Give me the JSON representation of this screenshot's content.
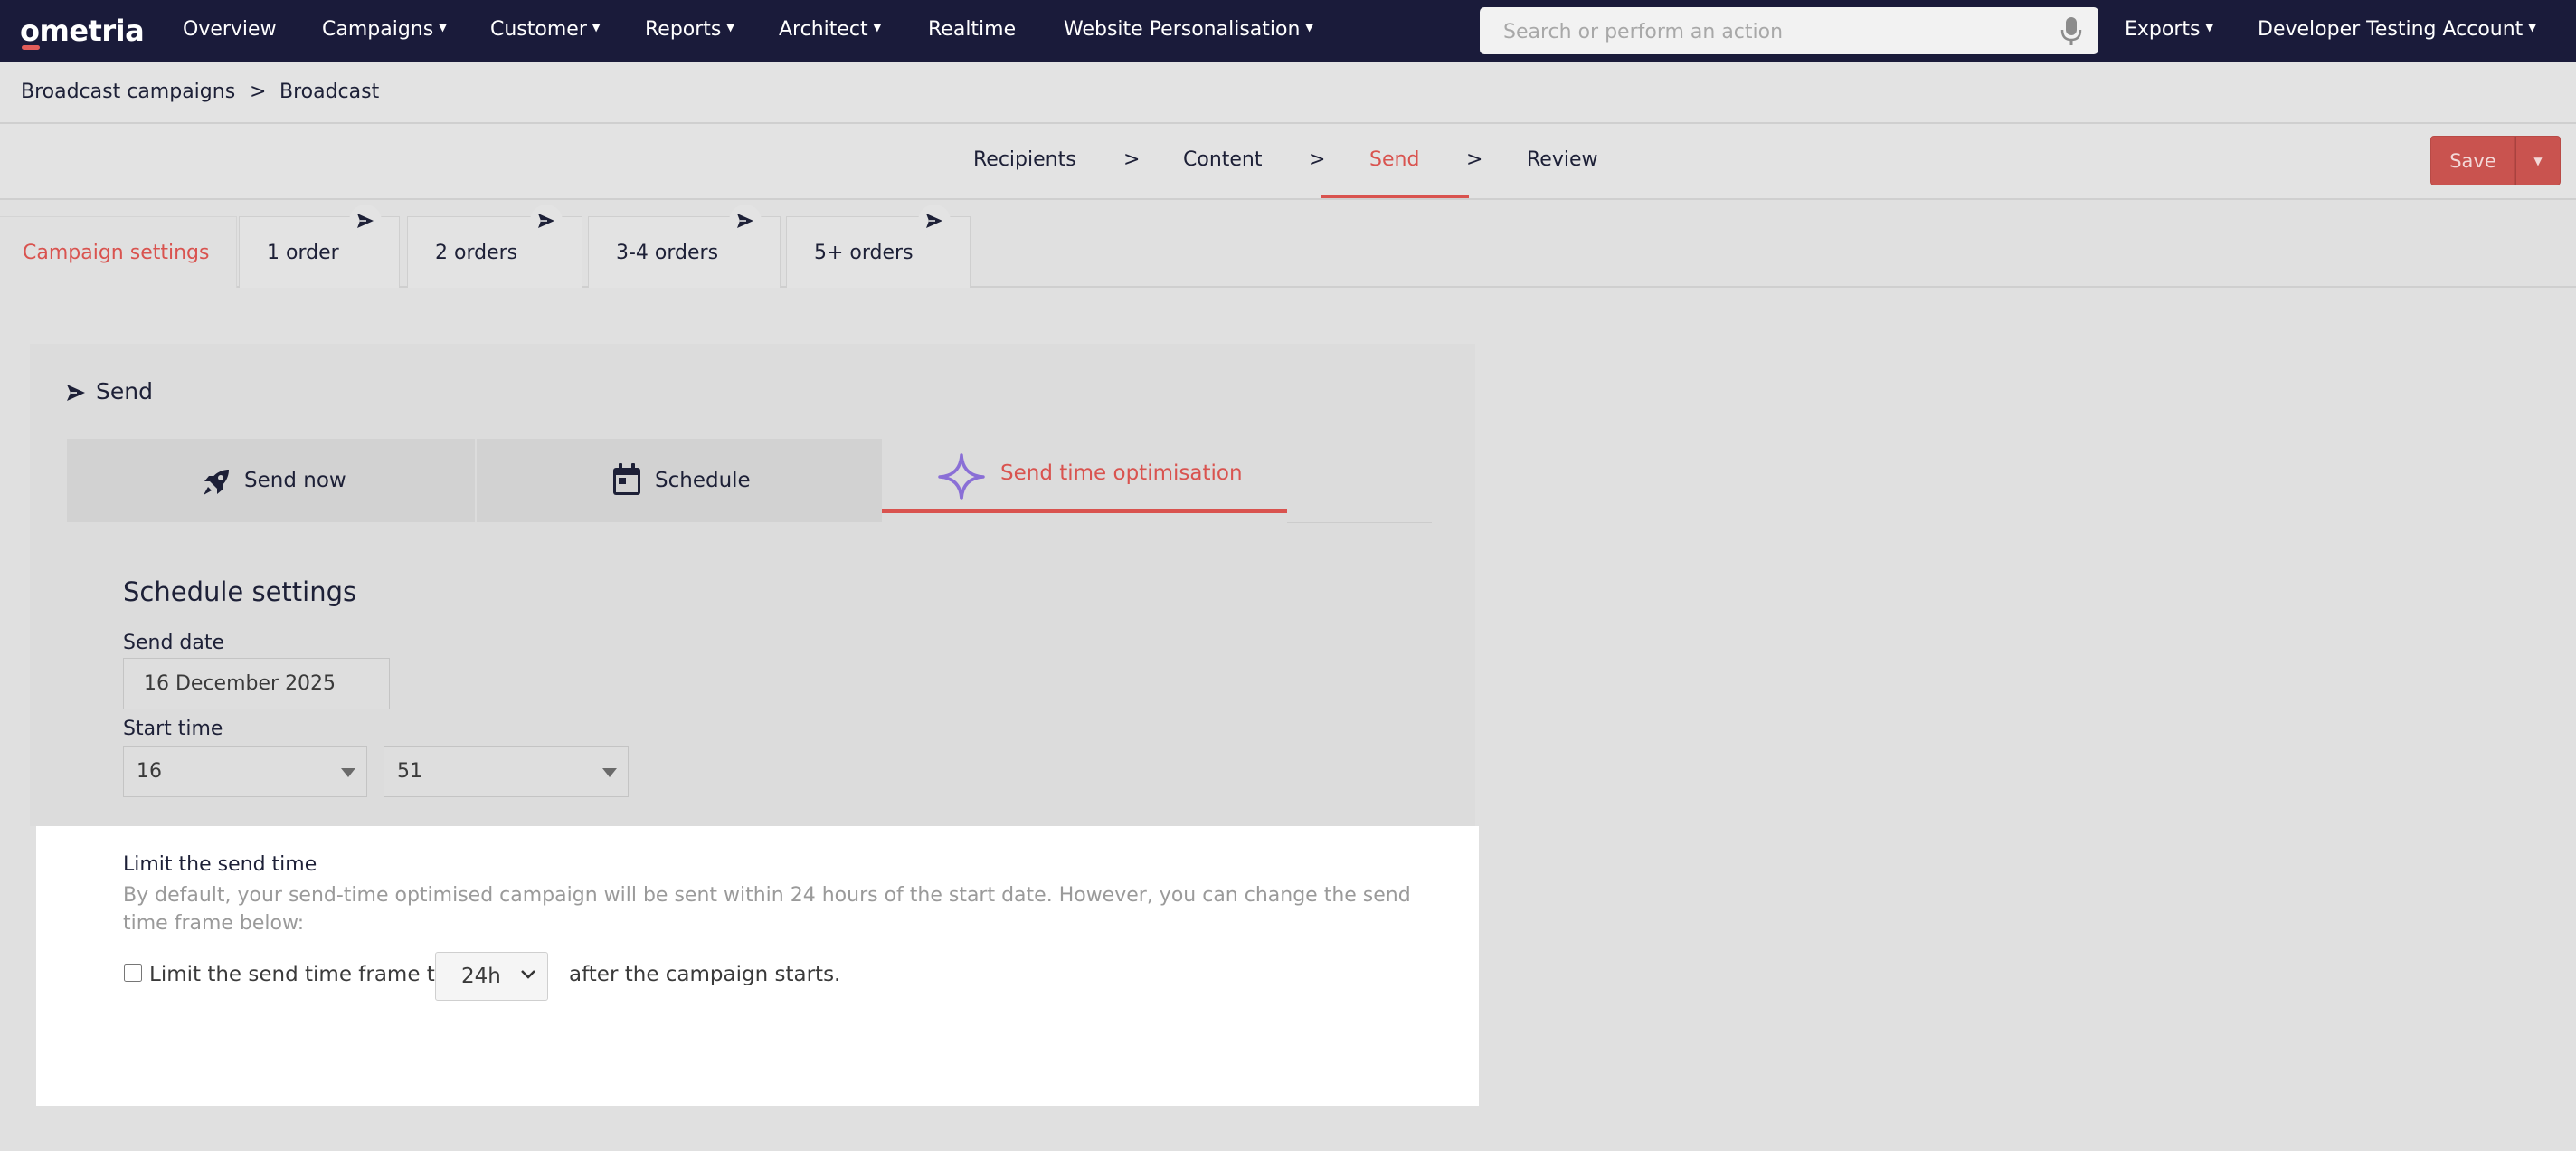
{
  "brand": {
    "logo_text": "ometria"
  },
  "nav": {
    "items": [
      {
        "label": "Overview",
        "dropdown": false
      },
      {
        "label": "Campaigns",
        "dropdown": true
      },
      {
        "label": "Customer",
        "dropdown": true
      },
      {
        "label": "Reports",
        "dropdown": true
      },
      {
        "label": "Architect",
        "dropdown": true
      },
      {
        "label": "Realtime",
        "dropdown": false
      },
      {
        "label": "Website Personalisation",
        "dropdown": true
      }
    ],
    "search_placeholder": "Search or perform an action",
    "exports_label": "Exports",
    "account_label": "Developer Testing Account"
  },
  "breadcrumb": {
    "parent": "Broadcast campaigns",
    "separator": ">",
    "current": "Broadcast"
  },
  "steps": {
    "items": [
      "Recipients",
      "Content",
      "Send",
      "Review"
    ],
    "separator": ">",
    "active": "Send"
  },
  "actions": {
    "save_label": "Save"
  },
  "segment_tabs": {
    "settings_label": "Campaign settings",
    "items": [
      "1 order",
      "2 orders",
      "3-4 orders",
      "5+ orders"
    ]
  },
  "send_panel": {
    "title": "Send",
    "modes": {
      "send_now": "Send now",
      "schedule": "Schedule",
      "sto": "Send time optimisation"
    },
    "active_mode": "Send time optimisation"
  },
  "schedule": {
    "title": "Schedule settings",
    "send_date_label": "Send date",
    "send_date_value": "16 December 2025",
    "start_time_label": "Start time",
    "hour_value": "16",
    "minute_value": "51"
  },
  "limit": {
    "title": "Limit the send time",
    "description": "By default, your send-time optimised campaign will be sent within 24 hours of the start date. However, you can change the send time frame below:",
    "checkbox_label": "Limit the send time frame to",
    "hours_value": "24h",
    "suffix": "after the campaign starts.",
    "checked": false
  },
  "colors": {
    "nav_bg": "#1a1b3a",
    "accent": "#d9534f",
    "sto_icon": "#8a6fd6"
  }
}
